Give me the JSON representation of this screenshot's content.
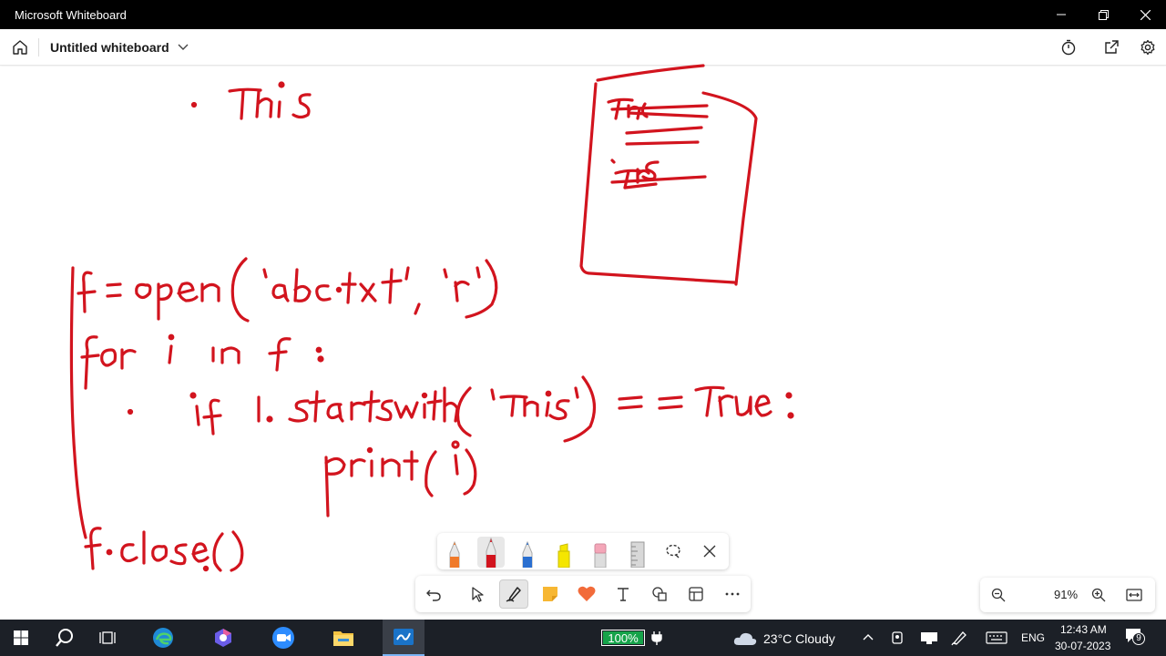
{
  "window": {
    "title": "Microsoft Whiteboard",
    "controls": [
      "minimize-icon",
      "restore-icon",
      "close-icon"
    ]
  },
  "appbar": {
    "board_name": "Untitled whiteboard",
    "right_icons": [
      "timer-icon",
      "share-icon",
      "settings-icon"
    ]
  },
  "canvas": {
    "ink_color": "#d2141e",
    "handwriting": {
      "line1": "This",
      "code1": "f = open('abc.txt', 'r')",
      "code2": "for i in f :",
      "code3": "if i.startswith('This') == True :",
      "code4": "print(i)",
      "code5": "f.close()",
      "doc_line1": "This",
      "doc_line2": "This"
    }
  },
  "pen_tray": {
    "pens": [
      {
        "name": "orange-pen",
        "color": "#f07a2a"
      },
      {
        "name": "red-pen",
        "color": "#d2141e",
        "selected": true
      },
      {
        "name": "blue-pen",
        "color": "#2a6fd0"
      },
      {
        "name": "yellow-highlighter",
        "color": "#f5e600"
      },
      {
        "name": "eraser",
        "color": "#f4a6b8"
      },
      {
        "name": "ruler",
        "color": "#b8b8b8"
      }
    ],
    "icons": [
      "lasso-icon",
      "close-icon"
    ]
  },
  "toolbar": {
    "tools": [
      "undo-icon",
      "select-icon",
      "ink-icon",
      "sticky-note-icon",
      "reaction-icon",
      "text-icon",
      "shapes-icon",
      "templates-icon",
      "more-icon"
    ],
    "selected": "ink-icon"
  },
  "zoom": {
    "value": "91%"
  },
  "taskbar": {
    "battery": "100%",
    "weather": "23°C  Cloudy",
    "language": "ENG",
    "time": "12:43 AM",
    "date": "30-07-2023",
    "notifications": "9",
    "apps": [
      "windows-start-icon",
      "search-icon",
      "task-view-icon",
      "edge-icon",
      "copilot-icon",
      "zoom-icon",
      "file-explorer-icon",
      "whiteboard-icon"
    ],
    "colors": {
      "accent": "#7ab4f5",
      "battery": "#16a34a"
    }
  }
}
